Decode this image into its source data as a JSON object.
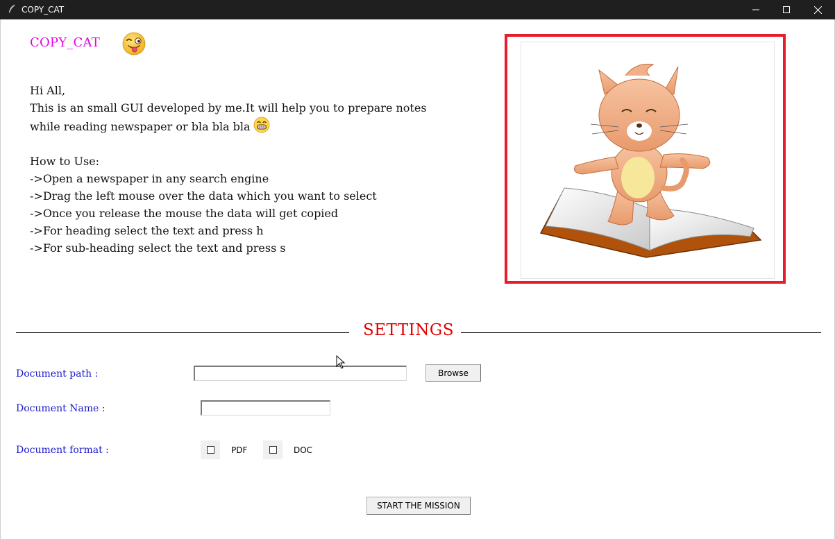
{
  "window": {
    "title": "COPY_CAT"
  },
  "header": {
    "app_title": "COPY_CAT",
    "emoji_icon": "winking-tongue-face-icon"
  },
  "intro": {
    "greeting": "Hi All,",
    "line1": "This is an small GUI developed by me.It will help you to prepare notes",
    "line2": "while reading newspaper or bla bla bla",
    "line2_emoji_icon": "grinning-face-icon",
    "how_to_title": "How to Use:",
    "steps": [
      "->Open a newspaper in any search engine",
      "->Drag the left mouse over the data which you want to select",
      "->Once you release the mouse the data will get copied",
      "->For heading select the text and press h",
      "->For sub-heading select the text and press s"
    ]
  },
  "illustration": {
    "icon": "cat-on-book-icon",
    "frame_color": "#e81d2b"
  },
  "settings": {
    "title": "SETTINGS",
    "title_color": "#e00000",
    "label_color": "#1a1acc",
    "document_path": {
      "label": "Document path :",
      "value": "",
      "browse_label": "Browse"
    },
    "document_name": {
      "label": "Document Name :",
      "value": ""
    },
    "document_format": {
      "label": "Document format  :",
      "options": [
        {
          "label": "PDF",
          "checked": false
        },
        {
          "label": "DOC",
          "checked": false
        }
      ]
    },
    "start_button": "START THE MISSION"
  }
}
